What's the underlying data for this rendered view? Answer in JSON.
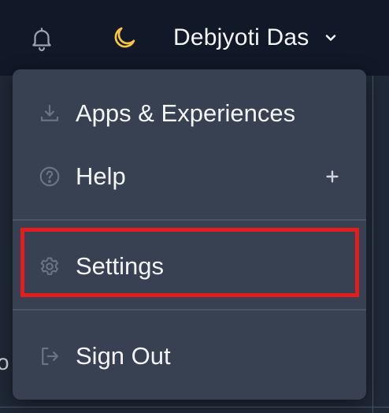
{
  "header": {
    "user_name": "Debjyoti Das",
    "icons": {
      "notifications": "bell-icon",
      "theme": "moon-icon",
      "dropdown": "chevron-down-icon"
    }
  },
  "background": {
    "fragment_text": "o"
  },
  "menu": {
    "items": [
      {
        "label": "Apps & Experiences",
        "icon": "download-icon"
      },
      {
        "label": "Help",
        "icon": "help-circle-icon",
        "expand_icon": "plus-icon"
      },
      {
        "label": "Settings",
        "icon": "gear-icon",
        "highlighted": true
      },
      {
        "label": "Sign Out",
        "icon": "sign-out-icon"
      }
    ]
  },
  "colors": {
    "header_bg": "#111827",
    "menu_bg": "#374151",
    "moon_accent": "#f6c445",
    "highlight_border": "#e11d1d",
    "text": "#f3f4f6"
  }
}
